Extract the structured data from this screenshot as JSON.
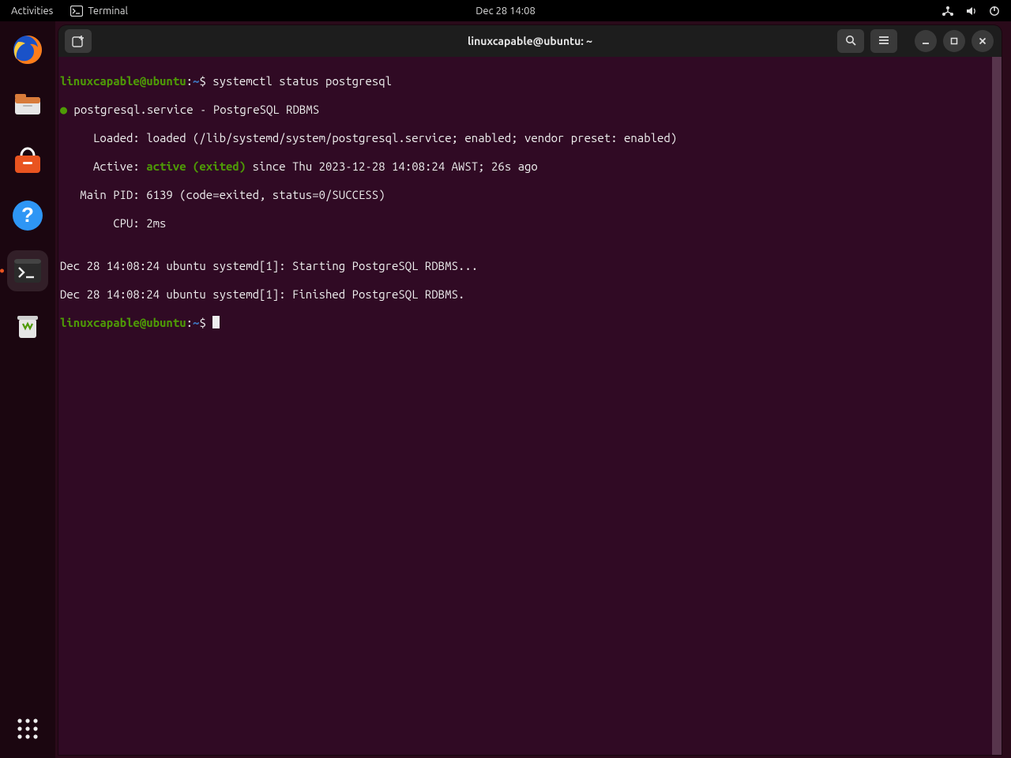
{
  "topbar": {
    "activities": "Activities",
    "app_name": "Terminal",
    "clock": "Dec 28  14:08"
  },
  "dock": {
    "items": [
      "firefox",
      "files",
      "software",
      "help",
      "terminal",
      "trash"
    ],
    "active_index": 4
  },
  "window": {
    "title": "linuxcapable@ubuntu: ~",
    "new_tab_label": "New Tab"
  },
  "prompt": {
    "user": "linuxcapable",
    "at": "@",
    "host": "ubuntu",
    "path": "~",
    "dollar": "$"
  },
  "terminal": {
    "command": "systemctl status postgresql",
    "svc_line": " postgresql.service - PostgreSQL RDBMS",
    "loaded": "     Loaded: loaded (/lib/systemd/system/postgresql.service; enabled; vendor preset: enabled)",
    "active_prefix": "     Active: ",
    "active_value": "active (exited)",
    "active_suffix": " since Thu 2023-12-28 14:08:24 AWST; 26s ago",
    "mainpid": "   Main PID: 6139 (code=exited, status=0/SUCCESS)",
    "cpu": "        CPU: 2ms",
    "blank": "",
    "log1": "Dec 28 14:08:24 ubuntu systemd[1]: Starting PostgreSQL RDBMS...",
    "log2": "Dec 28 14:08:24 ubuntu systemd[1]: Finished PostgreSQL RDBMS."
  }
}
